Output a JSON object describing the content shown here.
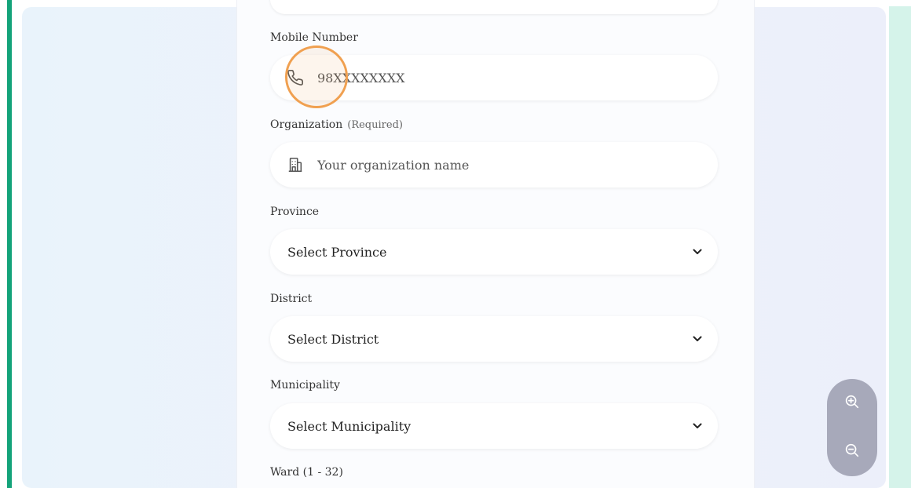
{
  "form": {
    "mobile": {
      "label": "Mobile Number",
      "placeholder": "98XXXXXXXX"
    },
    "organization": {
      "label": "Organization",
      "required_note": "(Required)",
      "placeholder": "Your organization name"
    },
    "province": {
      "label": "Province",
      "selected": "Select Province"
    },
    "district": {
      "label": "District",
      "selected": "Select District"
    },
    "municipality": {
      "label": "Municipality",
      "selected": "Select Municipality"
    },
    "ward": {
      "label": "Ward (1 - 32)"
    }
  },
  "icons": {
    "phone": "phone-icon",
    "building": "building-icon",
    "chevron": "chevron-down-icon",
    "zoom_in": "zoom-in-icon",
    "zoom_out": "zoom-out-icon"
  },
  "colors": {
    "accent_green": "#14a37a",
    "cursor_ring": "#f0a050",
    "zoom_control": "#a7a9ba",
    "right_strip": "#d5f3ea"
  }
}
